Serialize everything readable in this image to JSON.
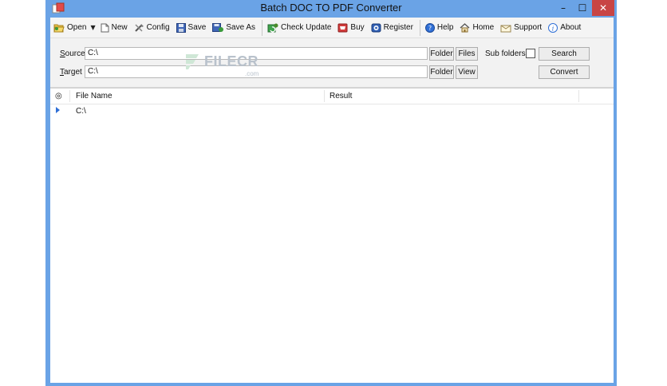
{
  "window": {
    "title": "Batch DOC TO PDF Converter",
    "controls": {
      "minimize": "–",
      "maximize": "☐",
      "close": "✕"
    }
  },
  "toolbar": {
    "open": "Open",
    "new": "New",
    "config": "Config",
    "save": "Save",
    "save_as": "Save As",
    "check_update": "Check Update",
    "buy": "Buy",
    "register": "Register",
    "help": "Help",
    "home": "Home",
    "support": "Support",
    "about": "About"
  },
  "panel": {
    "source_label_key": "S",
    "source_label_rest": "ource",
    "source_value": "C:\\",
    "target_label_key": "T",
    "target_label_rest": "arget",
    "target_value": "C:\\",
    "folder1": "Folder",
    "files": "Files",
    "sub_folders": "Sub folders",
    "search": "Search",
    "folder2": "Folder",
    "view": "View",
    "convert": "Convert"
  },
  "grid": {
    "col_icon": "◎",
    "col_file_name": "File Name",
    "col_result": "Result",
    "rows": [
      {
        "file_name": "C:\\",
        "result": ""
      }
    ]
  },
  "watermark": {
    "text": "FILECR",
    "suffix": ".com"
  },
  "colors": {
    "frame": "#6aa3e6",
    "close": "#c84545",
    "accent": "#2f6fd6"
  }
}
